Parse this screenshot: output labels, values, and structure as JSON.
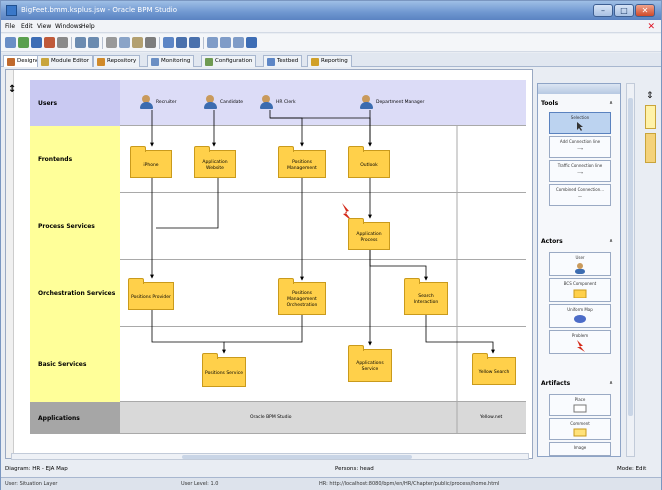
{
  "window": {
    "title": "BigFeet.bmm.ksplus.jsw - Oracle BPM Studio"
  },
  "menu": [
    "File",
    "Edit",
    "View",
    "Windows",
    "Help"
  ],
  "tabs": [
    {
      "label": "Designer",
      "active": true
    },
    {
      "label": "Module Editor",
      "active": false
    },
    {
      "label": "Repository",
      "active": false
    },
    {
      "label": "Monitoring",
      "active": false
    },
    {
      "label": "Configuration",
      "active": false
    },
    {
      "label": "Testbed",
      "active": false
    },
    {
      "label": "Reporting",
      "active": false
    }
  ],
  "diagram": {
    "lanes": [
      {
        "label": "Users",
        "color": "#c9c9f2"
      },
      {
        "label": "Frontends",
        "color": "#ffff99"
      },
      {
        "label": "Process Services",
        "color": "#ffff99"
      },
      {
        "label": "Orchestration Services",
        "color": "#ffff99"
      },
      {
        "label": "Basic Services",
        "color": "#ffff99"
      },
      {
        "label": "Applications",
        "color": "#a6a6a6"
      }
    ],
    "actors": [
      "Recruiter",
      "Candidate",
      "HR Clerk",
      "Department Manager"
    ],
    "folders": [
      "iPhone",
      "Application Website",
      "Positions Management",
      "Outlook",
      "Application Process",
      "Positions Provider",
      "Positions Management Orchestration",
      "Search Interaction",
      "Positions Service",
      "Applications Service",
      "Yellow Search"
    ],
    "applications": [
      "Oracle BPM Studio",
      "Yellow.net"
    ]
  },
  "status": {
    "left": "Diagram: HR - EJA Map",
    "center": "Persons: head",
    "right": "Mode: Edit"
  },
  "statusbar": {
    "item1": "User: Situation Layer",
    "item2": "User Level: 1.0",
    "item3": "HR: http://localhost:8080/bpm/en/HR/Chapter/public/process/home.html"
  },
  "palette": {
    "sections": [
      "Tools",
      "Actors",
      "Artifacts"
    ],
    "tools": [
      "Selection",
      "Add Connection line",
      "Traffic Connection line",
      "Combined Connection..."
    ],
    "actors": [
      "User",
      "BCS Component",
      "Uniform Map",
      "Problem"
    ],
    "artifacts": [
      "Place",
      "Comment",
      "Image"
    ]
  },
  "colors": {
    "folder": "#ffd04a",
    "users_lane": "#c9c9f2",
    "lane": "#ffff99",
    "applications_lane": "#a6a6a6"
  }
}
